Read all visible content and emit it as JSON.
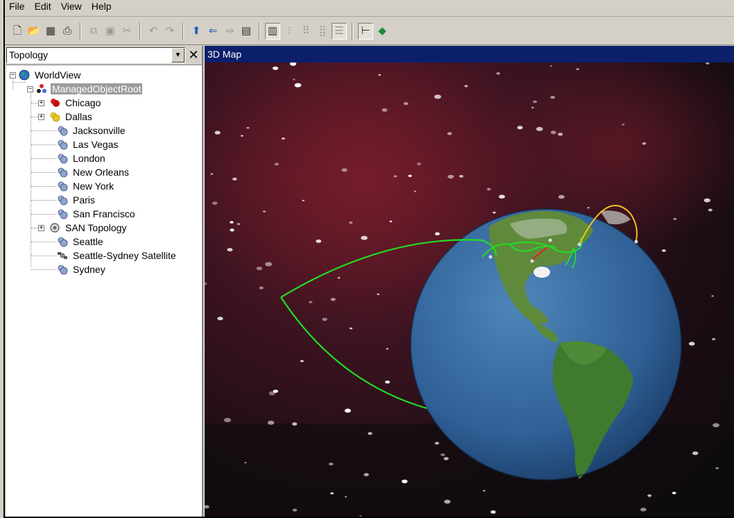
{
  "menubar": [
    "File",
    "Edit",
    "View",
    "Help"
  ],
  "toolbar": {
    "icons": [
      "new-icon",
      "open-icon",
      "network-icon",
      "print-icon",
      "copy-icon",
      "paste-icon",
      "cut-icon",
      "undo-icon",
      "redo-icon",
      "up-icon",
      "back-icon",
      "forward-icon",
      "details-icon",
      "large-icons-view-icon",
      "small-icons-view-icon",
      "list-view-icon",
      "detail-list-view-icon",
      "report-view-icon",
      "tree-view-icon",
      "book-icon"
    ]
  },
  "left_pane": {
    "selector_value": "Topology",
    "close_glyph": "✕",
    "tree": {
      "root": "WorldView",
      "managed_root": "ManagedObjectRoot",
      "items": [
        {
          "label": "Chicago",
          "expandable": true,
          "icon": "site-red-icon"
        },
        {
          "label": "Dallas",
          "expandable": true,
          "icon": "site-yellow-icon"
        },
        {
          "label": "Jacksonville",
          "expandable": false,
          "icon": "site-icon"
        },
        {
          "label": "Las Vegas",
          "expandable": false,
          "icon": "site-icon"
        },
        {
          "label": "London",
          "expandable": false,
          "icon": "site-icon"
        },
        {
          "label": "New Orleans",
          "expandable": false,
          "icon": "site-icon"
        },
        {
          "label": "New York",
          "expandable": false,
          "icon": "site-icon"
        },
        {
          "label": "Paris",
          "expandable": false,
          "icon": "site-icon"
        },
        {
          "label": "San Francisco",
          "expandable": false,
          "icon": "site-icon"
        },
        {
          "label": "SAN Topology",
          "expandable": true,
          "icon": "san-topology-icon"
        },
        {
          "label": "Seattle",
          "expandable": false,
          "icon": "site-icon"
        },
        {
          "label": "Seattle-Sydney Satellite",
          "expandable": false,
          "icon": "satellite-icon"
        },
        {
          "label": "Sydney",
          "expandable": false,
          "icon": "site-icon"
        }
      ]
    }
  },
  "map": {
    "title": "3D Map",
    "link_colors": {
      "normal": "#22dd22",
      "warning": "#f0c020",
      "critical": "#e02020"
    }
  }
}
